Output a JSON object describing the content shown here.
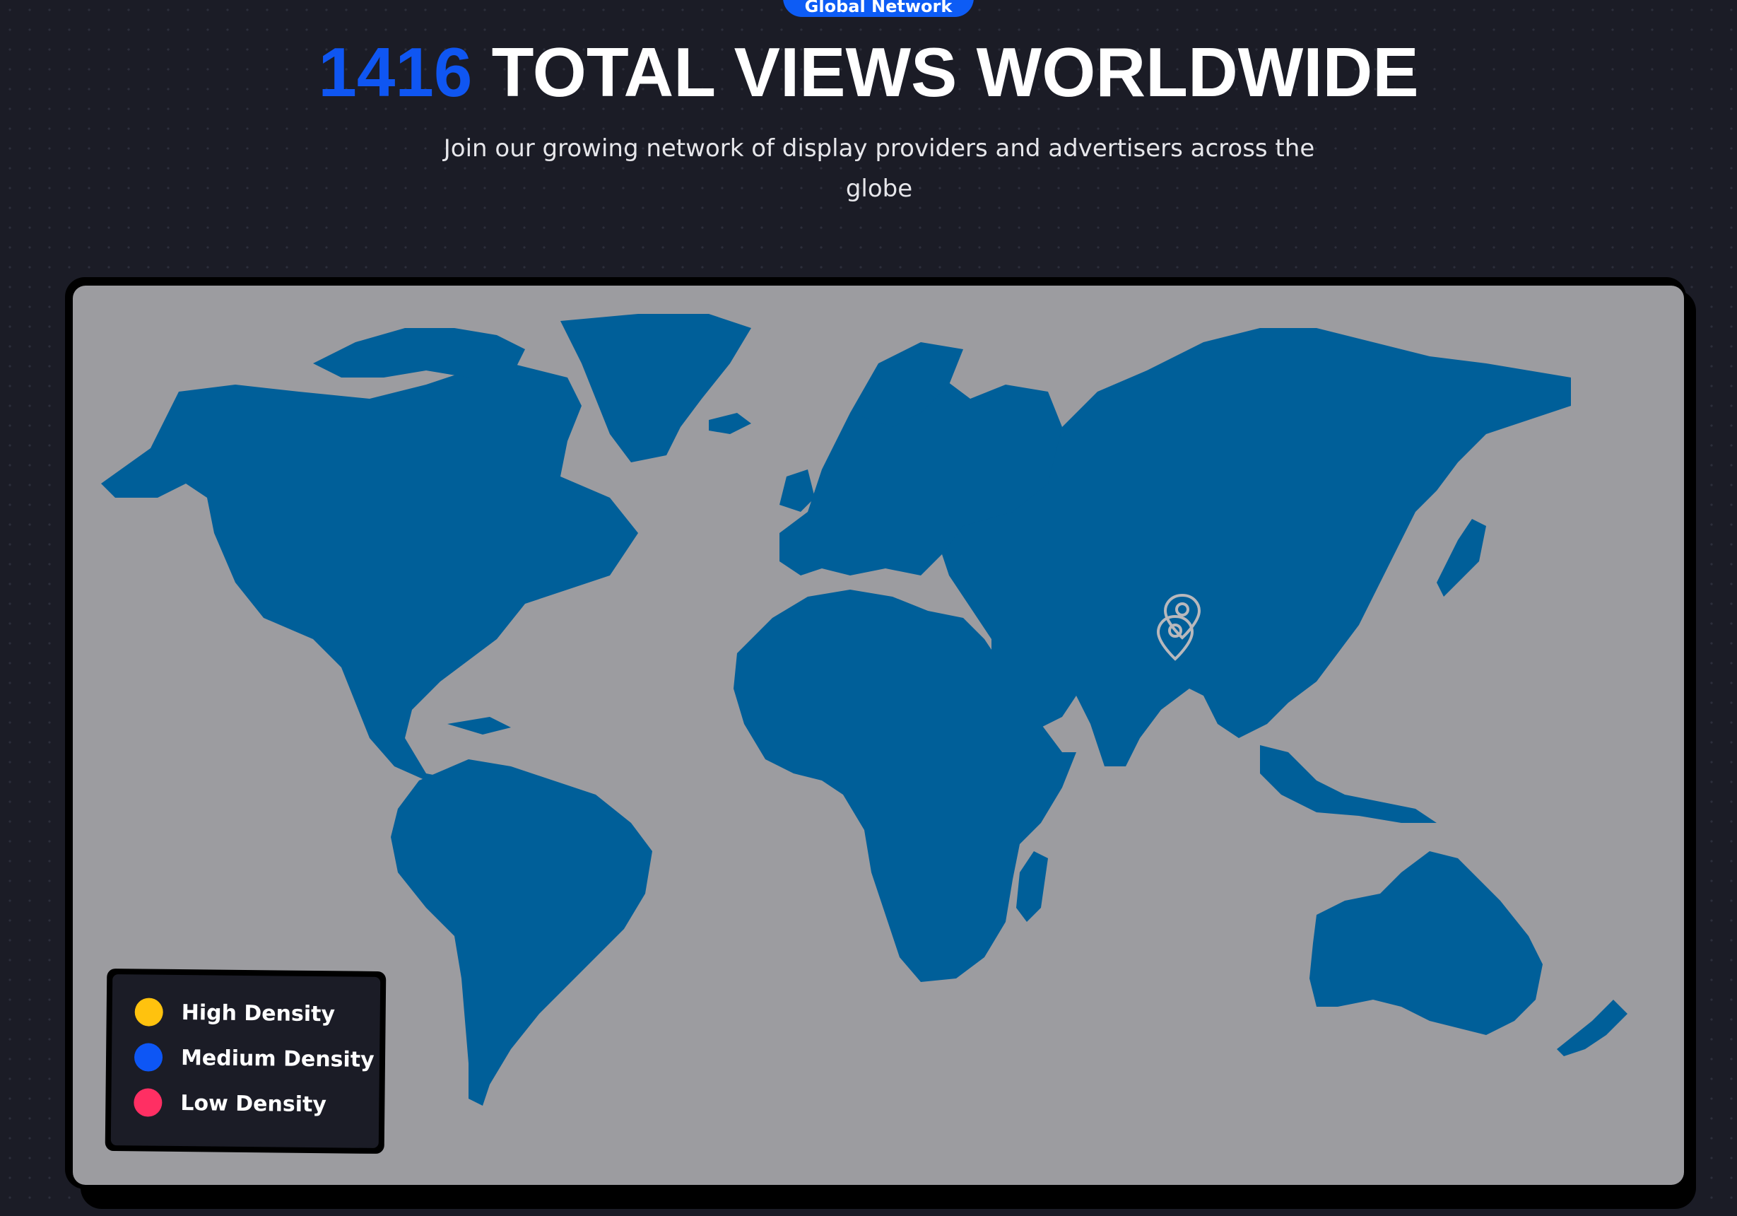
{
  "badge": {
    "label": "Global Network"
  },
  "header": {
    "count": "1416",
    "title_rest": " TOTAL VIEWS WORLDWIDE",
    "subtitle": "Join our growing network of display providers and advertisers across the globe"
  },
  "map": {
    "land_color": "#005f99",
    "ocean_color": "#9c9ca0",
    "marker_icon": "map-pin-icon",
    "markers": [
      {
        "label": "",
        "lat": 28.6,
        "lon": 77.2
      },
      {
        "label": "",
        "lat": 24.9,
        "lon": 75.8
      }
    ]
  },
  "legend": {
    "items": [
      {
        "label": "High Density",
        "color": "#ffc20e"
      },
      {
        "label": "Medium Density",
        "color": "#0d56f5"
      },
      {
        "label": "Low Density",
        "color": "#ff2f63"
      }
    ]
  }
}
